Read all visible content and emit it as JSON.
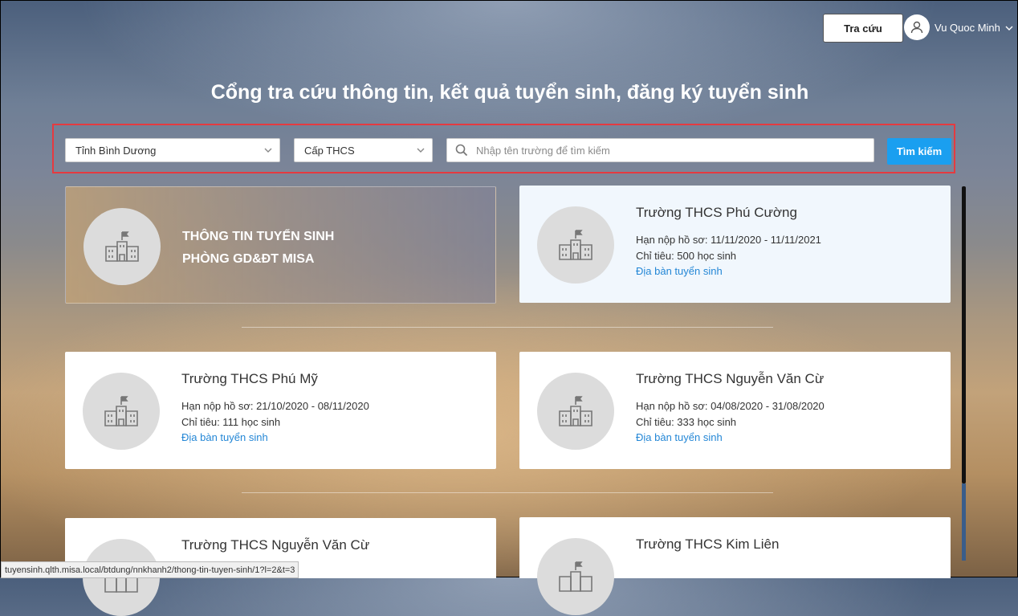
{
  "header": {
    "lookup_label": "Tra cứu",
    "user_name": "Vu Quoc Minh"
  },
  "page": {
    "title": "Cổng tra cứu thông tin, kết quả tuyển sinh, đăng ký tuyển sinh"
  },
  "search": {
    "province": "Tỉnh Bình Dương",
    "level": "Cấp THCS",
    "placeholder": "Nhập tên trường để tìm kiếm",
    "button_label": "Tìm kiếm"
  },
  "banner": {
    "line1": "THÔNG TIN TUYỂN SINH",
    "line2": "PHÒNG GD&ĐT MISA"
  },
  "schools": [
    {
      "name": "Trường THCS Phú Cường",
      "deadline": "Hạn nộp hồ sơ: 11/11/2020 - 11/11/2021",
      "quota": "Chỉ tiêu: 500 học sinh",
      "link": "Địa bàn tuyển sinh"
    },
    {
      "name": "Trường THCS Phú Mỹ",
      "deadline": "Hạn nộp hồ sơ: 21/10/2020 - 08/11/2020",
      "quota": "Chỉ tiêu: 111 học sinh",
      "link": "Địa bàn tuyển sinh"
    },
    {
      "name": "Trường THCS Nguyễn Văn Cừ",
      "deadline": "Hạn nộp hồ sơ: 04/08/2020 - 31/08/2020",
      "quota": "Chỉ tiêu: 333 học sinh",
      "link": "Địa bàn tuyển sinh"
    },
    {
      "name": "Trường THCS Nguyễn Văn Cừ"
    },
    {
      "name": "Trường THCS Kim Liên"
    }
  ],
  "statusbar": {
    "url": "tuyensinh.qlth.misa.local/btdung/nnkhanh2/thong-tin-tuyen-sinh/1?l=2&t=3"
  }
}
